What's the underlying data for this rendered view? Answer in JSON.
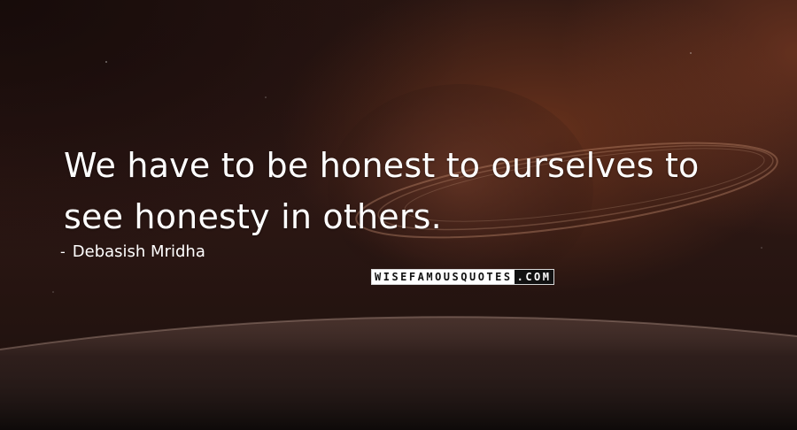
{
  "quote": {
    "text": "We have to be honest to ourselves to see honesty in others."
  },
  "author": {
    "dash": "-",
    "name": "Debasish Mridha"
  },
  "brand": {
    "part1": "WISEFAMOUSQUOTES",
    "part2": ".COM"
  },
  "colors": {
    "text": "#ffffff",
    "background_dark": "#1a0d0a",
    "glow": "#a04a2a"
  }
}
